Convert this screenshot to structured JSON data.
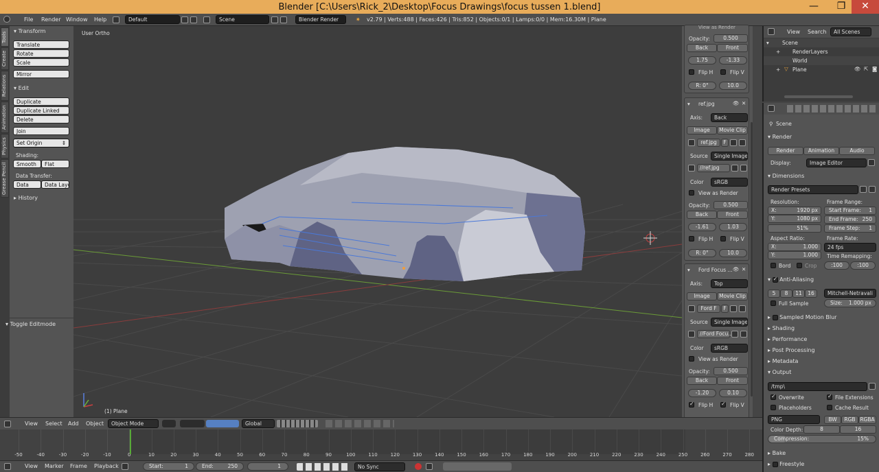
{
  "window": {
    "title": "Blender  [C:\\Users\\Rick_2\\Desktop\\Focus Drawings\\focus tussen 1.blend]",
    "minimize": "—",
    "maximize": "❐",
    "close": "✕"
  },
  "menu": {
    "file": "File",
    "render": "Render",
    "window": "Window",
    "help": "Help",
    "layout": "Default",
    "scene": "Scene",
    "engine": "Blender Render",
    "stats": "v2.79 | Verts:488 | Faces:426 | Tris:852 | Objects:0/1 | Lamps:0/0 | Mem:16.30M | Plane"
  },
  "tabs": [
    "Tools",
    "Create",
    "Relations",
    "Animation",
    "Physics",
    "Grease Pencil"
  ],
  "tool": {
    "transform": "Transform",
    "translate": "Translate",
    "rotate": "Rotate",
    "scale": "Scale",
    "mirror": "Mirror",
    "edit": "Edit",
    "duplicate": "Duplicate",
    "duplicate_linked": "Duplicate Linked",
    "delete": "Delete",
    "join": "Join",
    "set_origin": "Set Origin",
    "shading": "Shading:",
    "smooth": "Smooth",
    "flat": "Flat",
    "data_transfer": "Data Transfer:",
    "data": "Data",
    "data_layo": "Data Layo",
    "history": "History",
    "toggle_editmode": "Toggle Editmode"
  },
  "viewport": {
    "view_name": "User Ortho",
    "object_label": "(1) Plane"
  },
  "npanel": {
    "top_partial": "View as Render",
    "b1": {
      "opacity": "Opacity:",
      "opacity_val": "0.500",
      "back": "Back",
      "front": "Front",
      "x": "1.75",
      "y": "-1.33",
      "fliph": "Flip H",
      "flipv": "Flip V",
      "r": "R: 0°",
      "size": "10.0"
    },
    "b2": {
      "name": "ref.jpg",
      "axis": "Axis:",
      "axis_val": "Back",
      "image": "Image",
      "movie": "Movie Clip",
      "img_name": "ref.jpg",
      "f": "F",
      "source": "Source",
      "source_val": "Single Image",
      "path": "//ref.jpg",
      "color": "Color",
      "color_val": "sRGB",
      "view_render": "View as Render",
      "opacity": "Opacity:",
      "opacity_val": "0.500",
      "back": "Back",
      "front": "Front",
      "x": "-1.61",
      "y": "1.03",
      "fliph": "Flip H",
      "flipv": "Flip V",
      "r": "R: 0°",
      "size": "10.0"
    },
    "b3": {
      "name": "Ford Focus ...",
      "axis": "Axis:",
      "axis_val": "Top",
      "image": "Image",
      "movie": "Movie Clip",
      "img_name": "Ford F",
      "f": "F",
      "source": "Source",
      "source_val": "Single Image",
      "path": "//Ford Focu...",
      "color": "Color",
      "color_val": "sRGB",
      "view_render": "View as Render",
      "opacity": "Opacity:",
      "opacity_val": "0.500",
      "back": "Back",
      "front": "Front",
      "x": "-1.20",
      "y": "0.10",
      "fliph": "Flip H",
      "flipv": "Flip V"
    }
  },
  "outliner": {
    "view": "View",
    "search": "Search",
    "all_scenes": "All Scenes",
    "scene": "Scene",
    "renderlayers": "RenderLayers",
    "world": "World",
    "plane": "Plane"
  },
  "props": {
    "scene": "Scene",
    "render": "Render",
    "btn_render": "Render",
    "btn_anim": "Animation",
    "btn_audio": "Audio",
    "display": "Display:",
    "display_val": "Image Editor",
    "dimensions": "Dimensions",
    "presets": "Render Presets",
    "resolution": "Resolution:",
    "res_x": "X:",
    "res_x_val": "1920 px",
    "res_y": "Y:",
    "res_y_val": "1080 px",
    "res_pct": "51%",
    "aspect": "Aspect Ratio:",
    "asp_x": "X:",
    "asp_x_val": "1.000",
    "asp_y": "Y:",
    "asp_y_val": "1.000",
    "border": "Bord",
    "crop": "Crop",
    "frame_range": "Frame Range:",
    "start_frame": "Start Frame:",
    "start_val": "1",
    "end_frame": "End Frame:",
    "end_val": "250",
    "frame_step": "Frame Step:",
    "step_val": "1",
    "frame_rate": "Frame Rate:",
    "fps": "24 fps",
    "time_remap": "Time Remapping:",
    "remap_a": ":100",
    "remap_b": ":100",
    "aa": "Anti-Aliasing",
    "aa5": "5",
    "aa8": "8",
    "aa11": "11",
    "aa16": "16",
    "filter": "Mitchell-Netravali",
    "full_sample": "Full Sample",
    "size": "Size:",
    "size_val": "1.000 px",
    "smb": "Sampled Motion Blur",
    "shading": "Shading",
    "performance": "Performance",
    "postproc": "Post Processing",
    "metadata": "Metadata",
    "output": "Output",
    "path": "/tmp\\",
    "overwrite": "Overwrite",
    "file_ext": "File Extensions",
    "placeholders": "Placeholders",
    "cache": "Cache Result",
    "format": "PNG",
    "bw": "BW",
    "rgb": "RGB",
    "rgba": "RGBA",
    "color_depth": "Color Depth:",
    "d8": "8",
    "d16": "16",
    "compression": "Compression:",
    "comp_val": "15%",
    "bake": "Bake",
    "freestyle": "Freestyle"
  },
  "vhdr": {
    "view": "View",
    "select": "Select",
    "add": "Add",
    "object": "Object",
    "mode": "Object Mode",
    "orientation": "Global"
  },
  "timeline": {
    "ticks": [
      "-50",
      "-40",
      "-30",
      "-20",
      "-10",
      "0",
      "10",
      "20",
      "30",
      "40",
      "50",
      "60",
      "70",
      "80",
      "90",
      "100",
      "110",
      "120",
      "130",
      "140",
      "150",
      "160",
      "170",
      "180",
      "190",
      "200",
      "210",
      "220",
      "230",
      "240",
      "250",
      "260",
      "270",
      "280"
    ],
    "current_frame": 0
  },
  "tlhdr": {
    "view": "View",
    "marker": "Marker",
    "frame": "Frame",
    "playback": "Playback",
    "start": "Start:",
    "start_val": "1",
    "end": "End:",
    "end_val": "250",
    "cur": "1",
    "sync": "No Sync"
  }
}
